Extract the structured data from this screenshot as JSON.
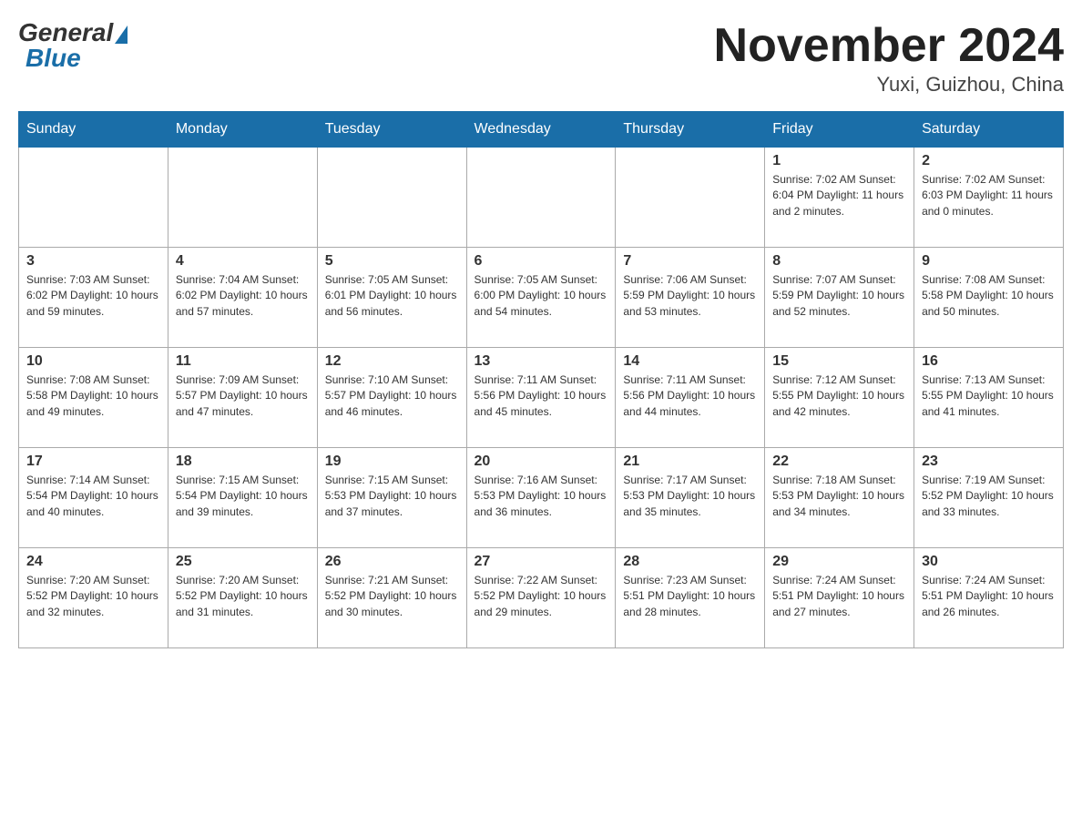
{
  "logo": {
    "general": "General",
    "blue": "Blue"
  },
  "title": "November 2024",
  "location": "Yuxi, Guizhou, China",
  "weekdays": [
    "Sunday",
    "Monday",
    "Tuesday",
    "Wednesday",
    "Thursday",
    "Friday",
    "Saturday"
  ],
  "weeks": [
    [
      {
        "day": "",
        "info": ""
      },
      {
        "day": "",
        "info": ""
      },
      {
        "day": "",
        "info": ""
      },
      {
        "day": "",
        "info": ""
      },
      {
        "day": "",
        "info": ""
      },
      {
        "day": "1",
        "info": "Sunrise: 7:02 AM\nSunset: 6:04 PM\nDaylight: 11 hours\nand 2 minutes."
      },
      {
        "day": "2",
        "info": "Sunrise: 7:02 AM\nSunset: 6:03 PM\nDaylight: 11 hours\nand 0 minutes."
      }
    ],
    [
      {
        "day": "3",
        "info": "Sunrise: 7:03 AM\nSunset: 6:02 PM\nDaylight: 10 hours\nand 59 minutes."
      },
      {
        "day": "4",
        "info": "Sunrise: 7:04 AM\nSunset: 6:02 PM\nDaylight: 10 hours\nand 57 minutes."
      },
      {
        "day": "5",
        "info": "Sunrise: 7:05 AM\nSunset: 6:01 PM\nDaylight: 10 hours\nand 56 minutes."
      },
      {
        "day": "6",
        "info": "Sunrise: 7:05 AM\nSunset: 6:00 PM\nDaylight: 10 hours\nand 54 minutes."
      },
      {
        "day": "7",
        "info": "Sunrise: 7:06 AM\nSunset: 5:59 PM\nDaylight: 10 hours\nand 53 minutes."
      },
      {
        "day": "8",
        "info": "Sunrise: 7:07 AM\nSunset: 5:59 PM\nDaylight: 10 hours\nand 52 minutes."
      },
      {
        "day": "9",
        "info": "Sunrise: 7:08 AM\nSunset: 5:58 PM\nDaylight: 10 hours\nand 50 minutes."
      }
    ],
    [
      {
        "day": "10",
        "info": "Sunrise: 7:08 AM\nSunset: 5:58 PM\nDaylight: 10 hours\nand 49 minutes."
      },
      {
        "day": "11",
        "info": "Sunrise: 7:09 AM\nSunset: 5:57 PM\nDaylight: 10 hours\nand 47 minutes."
      },
      {
        "day": "12",
        "info": "Sunrise: 7:10 AM\nSunset: 5:57 PM\nDaylight: 10 hours\nand 46 minutes."
      },
      {
        "day": "13",
        "info": "Sunrise: 7:11 AM\nSunset: 5:56 PM\nDaylight: 10 hours\nand 45 minutes."
      },
      {
        "day": "14",
        "info": "Sunrise: 7:11 AM\nSunset: 5:56 PM\nDaylight: 10 hours\nand 44 minutes."
      },
      {
        "day": "15",
        "info": "Sunrise: 7:12 AM\nSunset: 5:55 PM\nDaylight: 10 hours\nand 42 minutes."
      },
      {
        "day": "16",
        "info": "Sunrise: 7:13 AM\nSunset: 5:55 PM\nDaylight: 10 hours\nand 41 minutes."
      }
    ],
    [
      {
        "day": "17",
        "info": "Sunrise: 7:14 AM\nSunset: 5:54 PM\nDaylight: 10 hours\nand 40 minutes."
      },
      {
        "day": "18",
        "info": "Sunrise: 7:15 AM\nSunset: 5:54 PM\nDaylight: 10 hours\nand 39 minutes."
      },
      {
        "day": "19",
        "info": "Sunrise: 7:15 AM\nSunset: 5:53 PM\nDaylight: 10 hours\nand 37 minutes."
      },
      {
        "day": "20",
        "info": "Sunrise: 7:16 AM\nSunset: 5:53 PM\nDaylight: 10 hours\nand 36 minutes."
      },
      {
        "day": "21",
        "info": "Sunrise: 7:17 AM\nSunset: 5:53 PM\nDaylight: 10 hours\nand 35 minutes."
      },
      {
        "day": "22",
        "info": "Sunrise: 7:18 AM\nSunset: 5:53 PM\nDaylight: 10 hours\nand 34 minutes."
      },
      {
        "day": "23",
        "info": "Sunrise: 7:19 AM\nSunset: 5:52 PM\nDaylight: 10 hours\nand 33 minutes."
      }
    ],
    [
      {
        "day": "24",
        "info": "Sunrise: 7:20 AM\nSunset: 5:52 PM\nDaylight: 10 hours\nand 32 minutes."
      },
      {
        "day": "25",
        "info": "Sunrise: 7:20 AM\nSunset: 5:52 PM\nDaylight: 10 hours\nand 31 minutes."
      },
      {
        "day": "26",
        "info": "Sunrise: 7:21 AM\nSunset: 5:52 PM\nDaylight: 10 hours\nand 30 minutes."
      },
      {
        "day": "27",
        "info": "Sunrise: 7:22 AM\nSunset: 5:52 PM\nDaylight: 10 hours\nand 29 minutes."
      },
      {
        "day": "28",
        "info": "Sunrise: 7:23 AM\nSunset: 5:51 PM\nDaylight: 10 hours\nand 28 minutes."
      },
      {
        "day": "29",
        "info": "Sunrise: 7:24 AM\nSunset: 5:51 PM\nDaylight: 10 hours\nand 27 minutes."
      },
      {
        "day": "30",
        "info": "Sunrise: 7:24 AM\nSunset: 5:51 PM\nDaylight: 10 hours\nand 26 minutes."
      }
    ]
  ]
}
